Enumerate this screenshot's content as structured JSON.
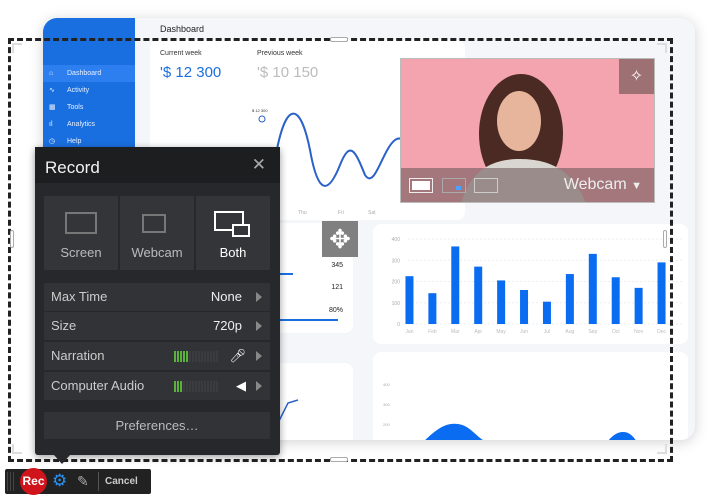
{
  "dashboard": {
    "title": "Dashboard",
    "sidebar": [
      {
        "label": "Dashboard",
        "icon": "home-icon"
      },
      {
        "label": "Activity",
        "icon": "activity-icon"
      },
      {
        "label": "Tools",
        "icon": "tools-icon"
      },
      {
        "label": "Analytics",
        "icon": "analytics-icon"
      },
      {
        "label": "Help",
        "icon": "help-icon"
      }
    ],
    "current_week": {
      "label": "Current week",
      "value": "'$ 12 300"
    },
    "previous_week": {
      "label": "Previous week",
      "value": "'$ 10 150"
    },
    "line_tooltip": "$ 12 300",
    "line_x_labels": [
      "Thu",
      "Fri",
      "Sat"
    ],
    "stats": [
      "345",
      "121",
      "80%"
    ],
    "bar_chart": {
      "type": "bar",
      "categories": [
        "Jan",
        "Feb",
        "Mar",
        "Apr",
        "May",
        "Jun",
        "Jul",
        "Aug",
        "Sep",
        "Oct",
        "Nov",
        "Dec"
      ],
      "values": [
        225,
        145,
        365,
        270,
        205,
        160,
        105,
        235,
        330,
        220,
        170,
        290
      ],
      "yticks": [
        "0",
        "100",
        "200",
        "300",
        "400"
      ],
      "ylim": [
        0,
        400
      ],
      "color": "#0a6cf0"
    },
    "area_yticks": [
      "100",
      "200",
      "300",
      "400"
    ]
  },
  "record": {
    "title": "Record",
    "modes": [
      {
        "label": "Screen"
      },
      {
        "label": "Webcam"
      },
      {
        "label": "Both",
        "selected": true
      }
    ],
    "max_time": {
      "label": "Max Time",
      "value": "None"
    },
    "size": {
      "label": "Size",
      "value": "720p"
    },
    "narration": {
      "label": "Narration",
      "level": 5,
      "segments": 15
    },
    "computer_audio": {
      "label": "Computer Audio",
      "level": 3,
      "segments": 15
    },
    "preferences": "Preferences…"
  },
  "webcam": {
    "label": "Webcam"
  },
  "toolbar": {
    "rec": "Rec",
    "cancel": "Cancel"
  },
  "colors": {
    "accent": "#1a6fe0",
    "rec": "#d0141c",
    "meter": "#5cb13a"
  }
}
